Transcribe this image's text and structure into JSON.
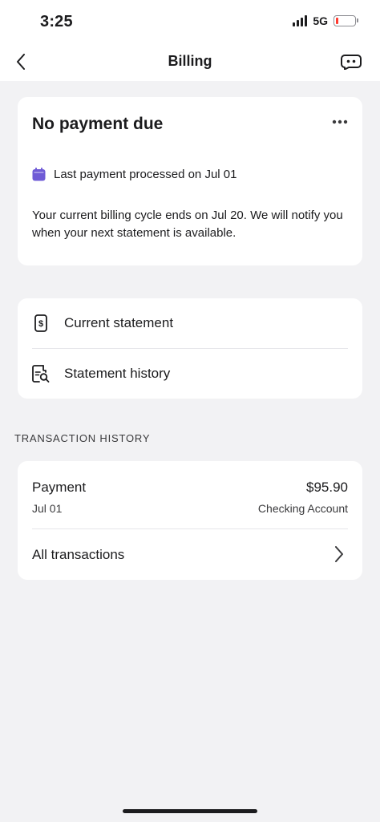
{
  "status_bar": {
    "time": "3:25",
    "network": "5G",
    "icons": [
      "signal-icon",
      "battery-icon"
    ],
    "battery_color": "#ff3b30"
  },
  "nav": {
    "title": "Billing",
    "icons": [
      "back-chevron-icon",
      "chat-bubble-icon"
    ]
  },
  "payment_card": {
    "title": "No payment due",
    "last_payment": "Last payment processed on Jul 01",
    "description": "Your current billing cycle ends on Jul 20. We will notify you when your next statement is available.",
    "icons": [
      "more-dots-icon",
      "calendar-icon"
    ],
    "calendar_color": "#6f5bd6"
  },
  "statements": {
    "items": [
      {
        "label": "Current statement",
        "icon": "statement-dollar-icon"
      },
      {
        "label": "Statement history",
        "icon": "statement-search-icon"
      }
    ]
  },
  "transaction_history": {
    "section_label": "TRANSACTION HISTORY",
    "transactions": [
      {
        "type": "Payment",
        "amount": "$95.90",
        "date": "Jul 01",
        "account": "Checking Account"
      }
    ],
    "all_label": "All transactions",
    "icons": [
      "chevron-right-icon"
    ]
  }
}
